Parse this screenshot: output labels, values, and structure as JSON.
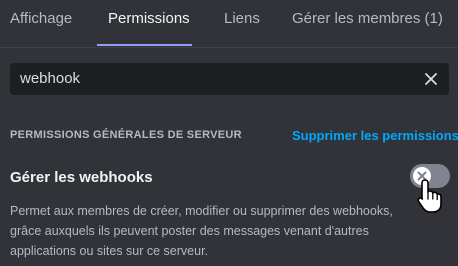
{
  "tabs": [
    {
      "label": "Affichage",
      "active": false
    },
    {
      "label": "Permissions",
      "active": true
    },
    {
      "label": "Liens",
      "active": false
    },
    {
      "label": "Gérer les membres (1)",
      "active": false
    }
  ],
  "search": {
    "value": "webhook"
  },
  "section": {
    "header": "PERMISSIONS GÉNÉRALES DE SERVEUR",
    "clear_link": "Supprimer les permissions"
  },
  "permission": {
    "title": "Gérer les webhooks",
    "description": "Permet aux membres de créer, modifier ou supprimer des webhooks, grâce auxquels ils peuvent poster des messages venant d'autres applications ou sites sur ce serveur.",
    "toggle_state": "off"
  },
  "colors": {
    "background": "#313338",
    "accent": "#949cf7",
    "link": "#00a8fc",
    "toggle_off": "#80848e"
  },
  "icons": {
    "clear": "close-icon",
    "toggle": "close-icon",
    "cursor": "hand-pointer-icon"
  }
}
